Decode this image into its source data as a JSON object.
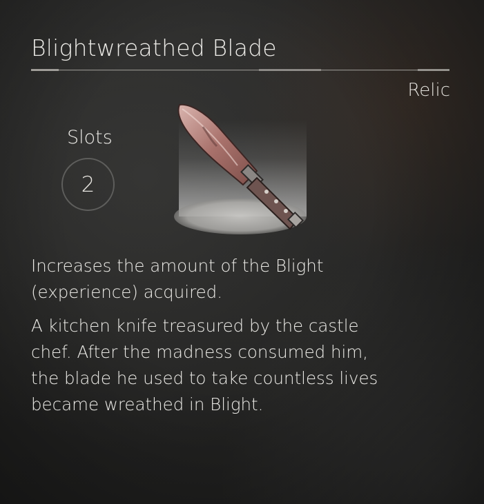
{
  "item": {
    "name": "Blightwreathed Blade",
    "category": "Relic",
    "slots_label": "Slots",
    "slots_value": "2",
    "effect": "Increases the amount of the Blight (experience) acquired.",
    "description": "A kitchen knife treasured by the castle chef. After the madness consumed him, the blade he used to take countless lives became wreathed in Blight.",
    "icon": "knife-icon"
  },
  "colors": {
    "text": "#ecebe7",
    "background": "#262625",
    "circle_border": "#5e5e5c"
  }
}
